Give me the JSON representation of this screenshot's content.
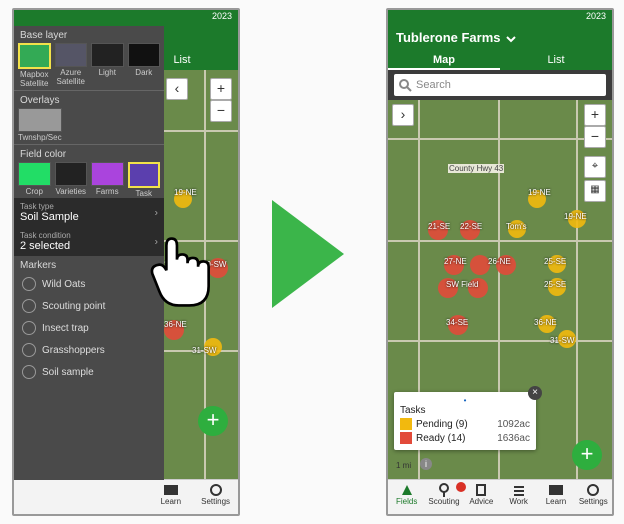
{
  "year": "2023",
  "farm_name": "Tublerone Farms",
  "tabs": {
    "map": "Map",
    "list": "List"
  },
  "search_placeholder": "Search",
  "panel": {
    "base_layer": "Base layer",
    "base_options": [
      "Mapbox Satellite",
      "Azure Satellite",
      "Light",
      "Dark"
    ],
    "overlays": "Overlays",
    "overlay_options": [
      "Twnshp/Sec"
    ],
    "field_color": "Field color",
    "color_options": [
      "Crop",
      "Varieties",
      "Farms",
      "Task"
    ],
    "task_type_label": "Task type",
    "task_type_value": "Soil Sample",
    "task_cond_label": "Task condition",
    "task_cond_value": "2 selected",
    "markers_label": "Markers",
    "markers": [
      "Wild Oats",
      "Scouting point",
      "Insect trap",
      "Grasshoppers",
      "Soil sample"
    ]
  },
  "map": {
    "hwy": "County Hwy 43",
    "field_labels": [
      "19-NE",
      "21-SE",
      "22-SE",
      "Tom's",
      "19-NE",
      "27-NE",
      "26-NE",
      "25-SE",
      "SW Field",
      "25-SE",
      "34-SE",
      "36-NE",
      "31-SW"
    ],
    "left_labels": [
      "19-NE",
      "25-SE",
      "29-SW",
      "36-NE",
      "31-SW"
    ],
    "scale": "1 mi"
  },
  "legend": {
    "title": "Tasks",
    "items": [
      {
        "name": "Pending (9)",
        "ac": "1092ac",
        "color": "#f2b90e"
      },
      {
        "name": "Ready (14)",
        "ac": "1636ac",
        "color": "#e24a3a"
      }
    ]
  },
  "nav_left": [
    "Learn",
    "Settings"
  ],
  "nav_right": [
    "Fields",
    "Scouting",
    "Advice",
    "Work",
    "Learn",
    "Settings"
  ]
}
